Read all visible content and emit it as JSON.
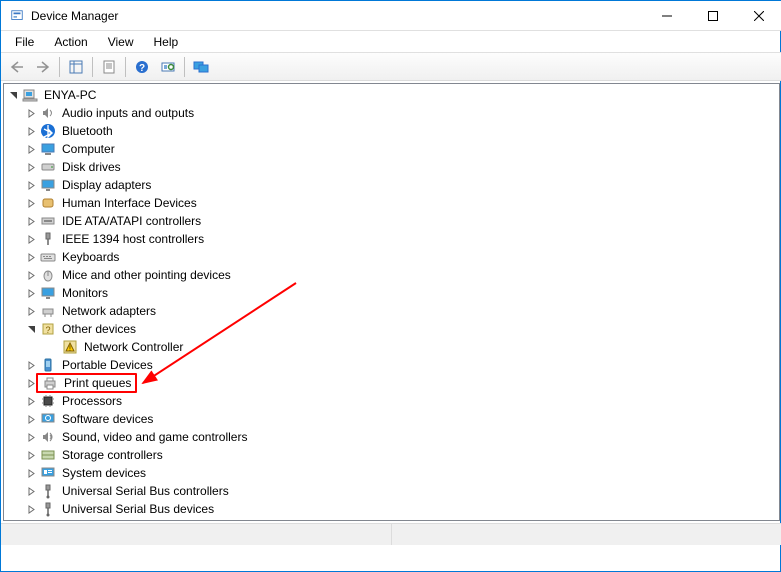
{
  "window": {
    "title": "Device Manager"
  },
  "menu": {
    "file": "File",
    "action": "Action",
    "view": "View",
    "help": "Help"
  },
  "toolbar": {
    "back": "back",
    "forward": "forward",
    "show_hide": "show-hide-console-tree",
    "properties": "properties",
    "help": "help",
    "scan": "scan-for-hardware",
    "monitors": "monitors"
  },
  "tree": {
    "root": {
      "label": "ENYA-PC",
      "expanded": true
    },
    "categories": [
      {
        "label": "Audio inputs and outputs",
        "expanded": false,
        "icon": "speaker"
      },
      {
        "label": "Bluetooth",
        "expanded": false,
        "icon": "bluetooth"
      },
      {
        "label": "Computer",
        "expanded": false,
        "icon": "computer"
      },
      {
        "label": "Disk drives",
        "expanded": false,
        "icon": "disk"
      },
      {
        "label": "Display adapters",
        "expanded": false,
        "icon": "display"
      },
      {
        "label": "Human Interface Devices",
        "expanded": false,
        "icon": "hid"
      },
      {
        "label": "IDE ATA/ATAPI controllers",
        "expanded": false,
        "icon": "ide"
      },
      {
        "label": "IEEE 1394 host controllers",
        "expanded": false,
        "icon": "ieee1394"
      },
      {
        "label": "Keyboards",
        "expanded": false,
        "icon": "keyboard"
      },
      {
        "label": "Mice and other pointing devices",
        "expanded": false,
        "icon": "mouse"
      },
      {
        "label": "Monitors",
        "expanded": false,
        "icon": "monitor"
      },
      {
        "label": "Network adapters",
        "expanded": false,
        "icon": "network"
      },
      {
        "label": "Other devices",
        "expanded": true,
        "icon": "other",
        "children": [
          {
            "label": "Network Controller",
            "icon": "warning"
          }
        ]
      },
      {
        "label": "Portable Devices",
        "expanded": false,
        "icon": "portable"
      },
      {
        "label": "Print queues",
        "expanded": false,
        "icon": "printer",
        "highlighted": true
      },
      {
        "label": "Processors",
        "expanded": false,
        "icon": "processor"
      },
      {
        "label": "Software devices",
        "expanded": false,
        "icon": "software"
      },
      {
        "label": "Sound, video and game controllers",
        "expanded": false,
        "icon": "sound"
      },
      {
        "label": "Storage controllers",
        "expanded": false,
        "icon": "storage"
      },
      {
        "label": "System devices",
        "expanded": false,
        "icon": "system"
      },
      {
        "label": "Universal Serial Bus controllers",
        "expanded": false,
        "icon": "usb"
      },
      {
        "label": "Universal Serial Bus devices",
        "expanded": false,
        "icon": "usb"
      }
    ]
  }
}
